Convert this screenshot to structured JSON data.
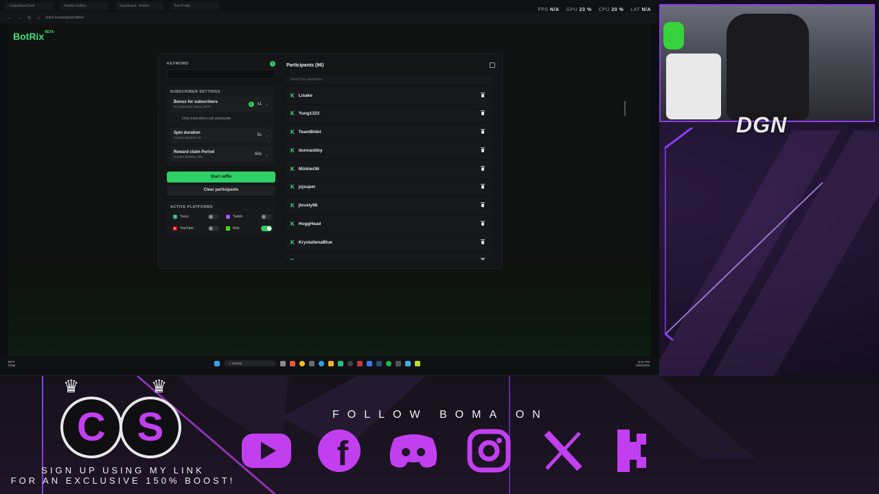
{
  "browser": {
    "tabs": [
      "CodeGlowCloud",
      "BotRix Raffles",
      "Dashboard · BotRix",
      "Bot Profile"
    ],
    "url": "botrix.live/widgets/raffles/",
    "perf": {
      "fps_label": "FPS",
      "fps": "N/A",
      "gpu_label": "GPU",
      "gpu": "23 %",
      "cpu_label": "CPU",
      "cpu": "20 %",
      "lat_label": "LAT",
      "lat": "N/A"
    }
  },
  "app": {
    "logo": "BotRix",
    "logo_badge": "BETA",
    "keyword_label": "KEYWORD",
    "subscriber_settings_label": "SUBSCRIBER SETTINGS",
    "bonus": {
      "title": "Bonus for subscribers",
      "subtitle": "No subscriber bonus (OFF)",
      "value": "x1"
    },
    "only_subs_label": "Only subscribers can participate",
    "spin": {
      "title": "Spin duration",
      "subtitle": "Current duration: 5s",
      "value": "5s"
    },
    "reward": {
      "title": "Reward claim Period",
      "subtitle": "Current duration: 60s",
      "value": "60s"
    },
    "start_button": "Start raffle",
    "clear_button": "Clear participants",
    "platforms_label": "ACTIVE PLATFORMS",
    "platforms": [
      {
        "name": "Trovo",
        "enabled": false,
        "color": "#1bb27a"
      },
      {
        "name": "Twitch",
        "enabled": false,
        "color": "#9146ff"
      },
      {
        "name": "YouTube",
        "enabled": false,
        "color": "#ff0000"
      },
      {
        "name": "Kick",
        "enabled": true,
        "color": "#53fc18"
      }
    ],
    "participants_title": "Participants (96)",
    "search_placeholder": "Search by username...",
    "participants": [
      "Lisake",
      "Yung1323",
      "TeamBidet",
      "donnaxbby",
      "Mizkiwi36",
      "jzjsuper",
      "jlovely98",
      "HoggHead",
      "KrystallenaBlue"
    ]
  },
  "taskbar": {
    "weather_temp": "80°F",
    "weather_desc": "Clear",
    "search": "Search",
    "time": "8:41 PM",
    "date": "5/25/2025"
  },
  "overlay": {
    "cam_tag": "DGN",
    "follow_text": "FOLLOW BOMA ON",
    "signup_line1": "SIGN UP USING MY LINK",
    "signup_line2": "FOR AN EXCLUSIVE 150% BOOST!",
    "cs_letters": [
      "C",
      "S"
    ],
    "socials": [
      "youtube-icon",
      "facebook-icon",
      "discord-icon",
      "instagram-icon",
      "x-icon",
      "kick-icon"
    ],
    "accent": "#c23ff0"
  }
}
